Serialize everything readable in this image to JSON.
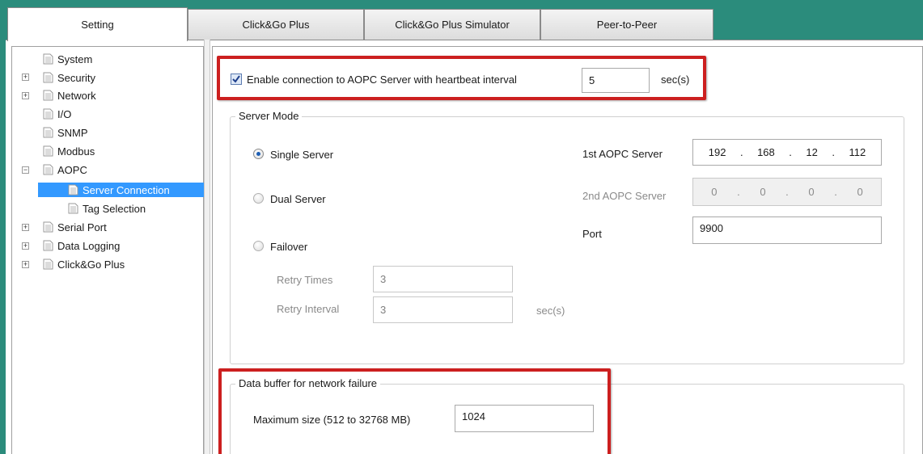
{
  "tabs": [
    {
      "label": "Setting",
      "active": true
    },
    {
      "label": "Click&Go Plus"
    },
    {
      "label": "Click&Go Plus Simulator"
    },
    {
      "label": "Peer-to-Peer"
    }
  ],
  "tree": {
    "items": [
      {
        "label": "System"
      },
      {
        "label": "Security"
      },
      {
        "label": "Network"
      },
      {
        "label": "I/O"
      },
      {
        "label": "SNMP"
      },
      {
        "label": "Modbus"
      },
      {
        "label": "AOPC"
      },
      {
        "label": "Server Connection",
        "selected": true
      },
      {
        "label": "Tag Selection"
      },
      {
        "label": "Serial Port"
      },
      {
        "label": "Data Logging"
      },
      {
        "label": "Click&Go Plus"
      }
    ]
  },
  "heartbeat": {
    "enable_label": "Enable connection to AOPC Server with heartbeat interval",
    "checked": true,
    "interval_value": "5",
    "unit": "sec(s)"
  },
  "server_mode": {
    "title": "Server Mode",
    "single_label": "Single Server",
    "dual_label": "Dual Server",
    "failover_label": "Failover",
    "selected": "Single Server",
    "retry_times_label": "Retry Times",
    "retry_times_value": "3",
    "retry_interval_label": "Retry Interval",
    "retry_interval_value": "3",
    "retry_interval_unit": "sec(s)",
    "first_server_label": "1st AOPC Server",
    "first_server_ip": [
      "192",
      "168",
      "12",
      "112"
    ],
    "second_server_label": "2nd AOPC Server",
    "second_server_ip": [
      "0",
      "0",
      "0",
      "0"
    ],
    "port_label": "Port",
    "port_value": "9900"
  },
  "data_buffer": {
    "title": "Data buffer for network failure",
    "max_size_label": "Maximum size (512 to 32768 MB)",
    "max_size_value": "1024"
  },
  "colors": {
    "accent_teal": "#2b8c7c",
    "selection_blue": "#3399ff",
    "highlight_red": "#cc1f1f"
  }
}
